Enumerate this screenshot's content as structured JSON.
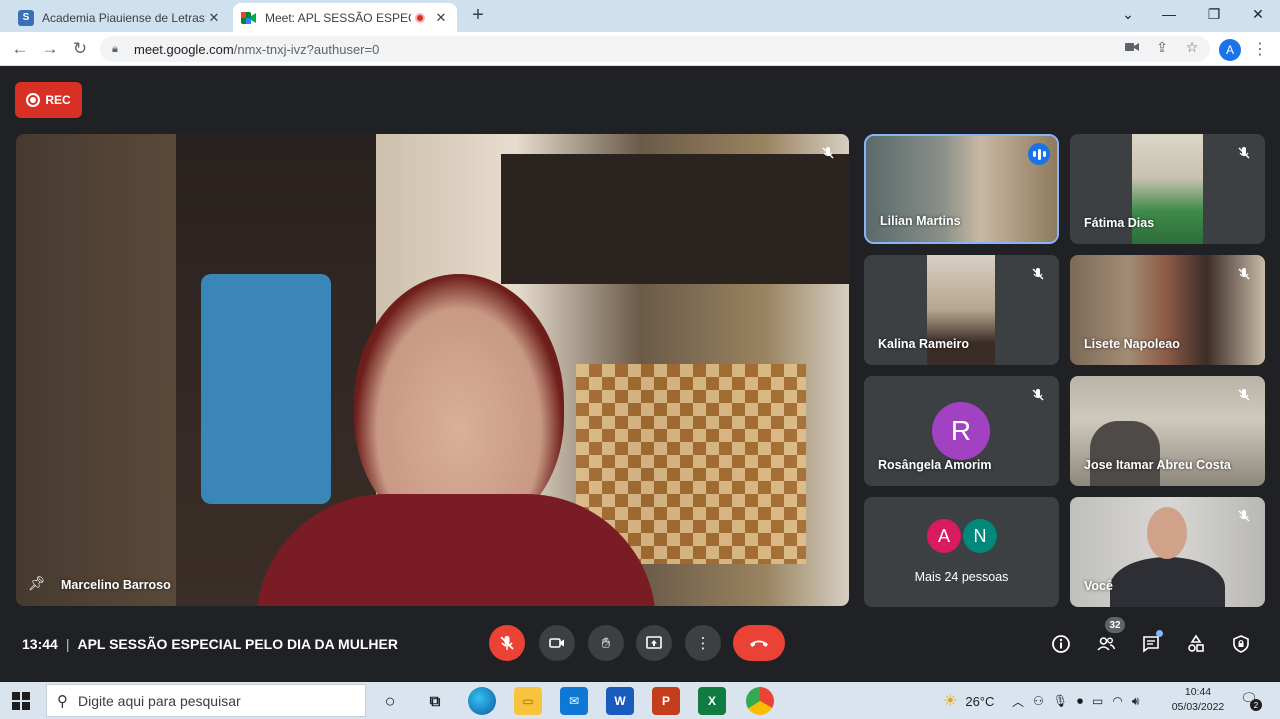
{
  "browser": {
    "tabs": [
      {
        "title": "Academia Piauiense de Letras: ag",
        "active": false,
        "favicon": "S"
      },
      {
        "title": "Meet: APL SESSÃO ESPECIAL",
        "active": true
      }
    ],
    "url_host": "meet.google.com",
    "url_path": "/nmx-tnxj-ivz?authuser=0",
    "profile_initial": "A"
  },
  "meet": {
    "rec_label": "REC",
    "main_speaker": "Marcelino Barroso",
    "participants": [
      {
        "name": "Lilian Martins",
        "speaking": true
      },
      {
        "name": "Fátima Dias",
        "muted": true
      },
      {
        "name": "Kalina Rameiro",
        "muted": true
      },
      {
        "name": "Lisete Napoleao",
        "muted": true
      },
      {
        "name": "Rosângela Amorim",
        "muted": true,
        "avatar": "R"
      },
      {
        "name": "Jose Itamar Abreu Costa",
        "muted": true
      },
      {
        "name": "Você",
        "muted": true
      }
    ],
    "more": {
      "avatars": [
        "A",
        "N"
      ],
      "label": "Mais 24 pessoas"
    },
    "time": "13:44",
    "separator": "|",
    "meeting_title": "APL SESSÃO ESPECIAL PELO DIA DA MULHER",
    "people_count": "32"
  },
  "taskbar": {
    "search_placeholder": "Digite aqui para pesquisar",
    "weather": "26°C",
    "time": "10:44",
    "date": "05/03/2022",
    "notifications": "2"
  },
  "colors": {
    "meet_bg": "#202124",
    "tile_bg": "#3c4043",
    "danger": "#ea4335",
    "accent": "#1a73e8"
  }
}
